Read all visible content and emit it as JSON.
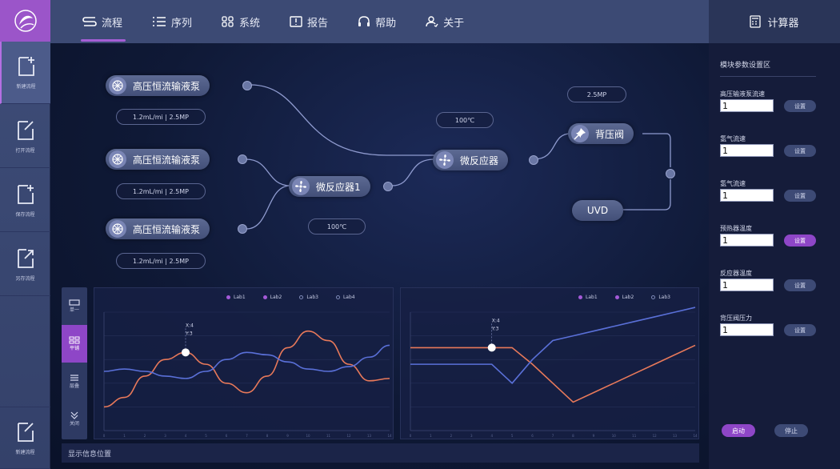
{
  "colors": {
    "accent": "#a55ed6",
    "lab1": "#a45ad8",
    "lab2": "#a45ad8",
    "orange": "#e8795a",
    "blue": "#5a70d8"
  },
  "sidebar": {
    "items": [
      {
        "label": "新建流程",
        "icon": "new-file-icon"
      },
      {
        "label": "打开流程",
        "icon": "open-file-icon"
      },
      {
        "label": "保存流程",
        "icon": "save-file-icon"
      },
      {
        "label": "另存流程",
        "icon": "export-file-icon"
      },
      {
        "label": "新建流程",
        "icon": "new-file-icon"
      }
    ]
  },
  "nav": {
    "items": [
      {
        "label": "流程",
        "icon": "flow-icon"
      },
      {
        "label": "序列",
        "icon": "list-icon"
      },
      {
        "label": "系统",
        "icon": "grid-icon"
      },
      {
        "label": "报告",
        "icon": "report-icon"
      },
      {
        "label": "帮助",
        "icon": "headset-icon"
      },
      {
        "label": "关于",
        "icon": "user-icon"
      }
    ]
  },
  "calculator": {
    "title": "计算器",
    "section_title": "模块参数设置区",
    "params": [
      {
        "label": "高压输液泵流速",
        "value": "1",
        "button": "设置"
      },
      {
        "label": "氢气流速",
        "value": "1",
        "button": "设置"
      },
      {
        "label": "氢气流速",
        "value": "1",
        "button": "设置"
      },
      {
        "label": "预热器温度",
        "value": "1",
        "button": "设置"
      },
      {
        "label": "反应器温度",
        "value": "1",
        "button": "设置"
      },
      {
        "label": "背压阀压力",
        "value": "1",
        "button": "设置"
      }
    ],
    "start_label": "启动",
    "stop_label": "停止"
  },
  "flow": {
    "pump1": "高压恒流输液泵",
    "pump2": "高压恒流输液泵",
    "pump3": "高压恒流输液泵",
    "pump1_tag": "1.2mL/mi  |  2.5MP",
    "pump2_tag": "1.2mL/mi  |  2.5MP",
    "pump3_tag": "1.2mL/mi  |  2.5MP",
    "reactor1": "微反应器1",
    "reactor1_tag": "100℃",
    "reactor2": "微反应器",
    "reactor2_tag": "100℃",
    "valve": "背压阀",
    "valve_tag": "2.5MP",
    "uvd": "UVD"
  },
  "toolbar": {
    "items": [
      {
        "label": "单一"
      },
      {
        "label": "平铺"
      },
      {
        "label": "层叠"
      },
      {
        "label": "关闭"
      }
    ]
  },
  "chart_data": [
    {
      "type": "line",
      "legend": [
        "Lab1",
        "Lab2",
        "Lab3",
        "Lab4"
      ],
      "tooltip": {
        "x_label": "X:4",
        "y_label": "Y:3"
      },
      "x": [
        0,
        1,
        2,
        3,
        4,
        5,
        6,
        7,
        8,
        9,
        10,
        11,
        12,
        13,
        14
      ],
      "series": [
        {
          "values": [
            1.0,
            1.4,
            2.3,
            3.0,
            3.3,
            2.8,
            2.0,
            1.6,
            2.3,
            3.5,
            4.2,
            3.8,
            2.8,
            2.1,
            2.2
          ]
        },
        {
          "values": [
            2.5,
            2.6,
            2.5,
            2.3,
            2.2,
            2.5,
            3.0,
            3.3,
            3.2,
            2.9,
            2.6,
            2.5,
            2.7,
            3.1,
            3.6
          ]
        }
      ]
    },
    {
      "type": "line",
      "legend": [
        "Lab1",
        "Lab2",
        "Lab3"
      ],
      "tooltip": {
        "x_label": "X:4",
        "y_label": "Y:3"
      },
      "x": [
        0,
        1,
        2,
        3,
        4,
        5,
        6,
        7,
        8,
        9,
        10,
        11,
        12,
        13,
        14
      ],
      "series": [
        {
          "values": [
            3.5,
            3.5,
            3.5,
            3.5,
            3.5,
            3.5,
            2.8,
            2.0,
            1.2,
            1.6,
            2.0,
            2.4,
            2.8,
            3.2,
            3.6
          ]
        },
        {
          "values": [
            2.8,
            2.8,
            2.8,
            2.8,
            2.8,
            2.0,
            3.0,
            3.8,
            4.0,
            4.2,
            4.4,
            4.6,
            4.8,
            5.0,
            5.2
          ]
        }
      ]
    }
  ],
  "status": {
    "text": "显示信息位置"
  }
}
